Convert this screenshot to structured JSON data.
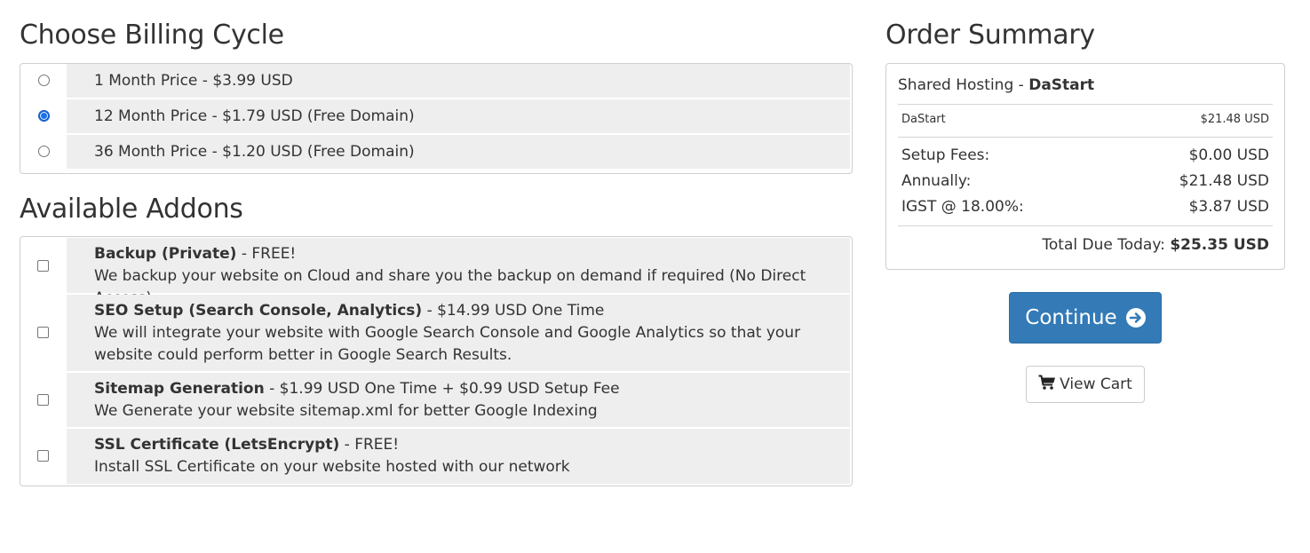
{
  "billing": {
    "title": "Choose Billing Cycle",
    "options": [
      {
        "label": "1 Month Price - $3.99 USD",
        "selected": false
      },
      {
        "label": "12 Month Price - $1.79 USD (Free Domain)",
        "selected": true
      },
      {
        "label": "36 Month Price - $1.20 USD (Free Domain)",
        "selected": false
      }
    ]
  },
  "addons": {
    "title": "Available Addons",
    "items": [
      {
        "name": "Backup (Private)",
        "price": " - FREE!",
        "description": "We backup your website on Cloud and share you the backup on demand if required (No Direct Access)",
        "checked": false
      },
      {
        "name": "SEO Setup (Search Console, Analytics)",
        "price": " - $14.99 USD One Time",
        "description": "We will integrate your website with Google Search Console and Google Analytics so that your website could perform better in Google Search Results.",
        "checked": false
      },
      {
        "name": "Sitemap Generation",
        "price": " - $1.99 USD One Time + $0.99 USD Setup Fee",
        "description": "We Generate your website sitemap.xml for better Google Indexing",
        "checked": false
      },
      {
        "name": "SSL Certificate (LetsEncrypt)",
        "price": " - FREE!",
        "description": "Install SSL Certificate on your website hosted with our network",
        "checked": false
      }
    ]
  },
  "summary": {
    "title": "Order Summary",
    "product_group": "Shared Hosting - ",
    "product_name": "DaStart",
    "line_item": {
      "label": "DaStart",
      "amount": "$21.48 USD"
    },
    "setup_fees": {
      "label": "Setup Fees:",
      "amount": "$0.00 USD"
    },
    "annually": {
      "label": "Annually:",
      "amount": "$21.48 USD"
    },
    "tax": {
      "label": "IGST @ 18.00%:",
      "amount": "$3.87 USD"
    },
    "total_label": "Total Due Today: ",
    "total_amount": "$25.35 USD"
  },
  "actions": {
    "continue_label": "Continue",
    "view_cart_label": "View Cart"
  },
  "colors": {
    "primary": "#337ab7",
    "row_background": "#eeeeee"
  }
}
